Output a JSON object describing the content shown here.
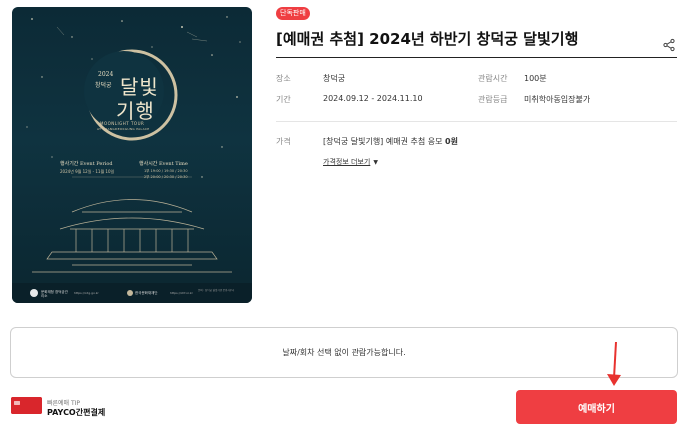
{
  "poster": {
    "year": "2024",
    "venue_small": "창덕궁",
    "title_line1": "달빛",
    "title_line2": "기행",
    "subtitle": "MOONLIGHT TOUR",
    "subtitle2": "AT CHANGDEOKGUNG PALACE",
    "period_label": "행사기간 Event Period",
    "period_dates": "2024년 9월 12일 - 11월 10일",
    "time_label": "행사시간 Event Time",
    "time_line1": "1부 19:00 / 19:30 / 20:30",
    "time_line2": "2부 20:00 / 20:30 / 20:30",
    "org1": "문화재청 창덕궁관리소",
    "org2": "한국문화재재단",
    "site1": "https://cdg.go.kr",
    "site2": "https://chf.or.kr",
    "footer_note": "문의 : 창덕궁 달빛기행 운영사무국"
  },
  "badge": "단독판매",
  "title": "[예매권 추첨] 2024년 하반기 창덕궁 달빛기행",
  "info": {
    "place_label": "장소",
    "place": "창덕궁",
    "runtime_label": "관람시간",
    "runtime": "100분",
    "period_label": "기간",
    "period": "2024.09.12 - 2024.11.10",
    "rating_label": "관람등급",
    "rating": "미취학아동입장불가"
  },
  "price": {
    "label": "가격",
    "item": "[창덕궁 달빛기행] 예매권 추첨 응모",
    "amount": "0원",
    "more": "가격정보 더보기"
  },
  "notice": "날짜/회차 선택 없이 관람가능합니다.",
  "payco": {
    "tip": "빠른예매 TIP",
    "name": "PAYCO간편결제"
  },
  "reserve_button": "예매하기",
  "colors": {
    "accent": "#ef3e42",
    "poster_bg": "#0f3340",
    "moon": "#d8c9a8"
  }
}
